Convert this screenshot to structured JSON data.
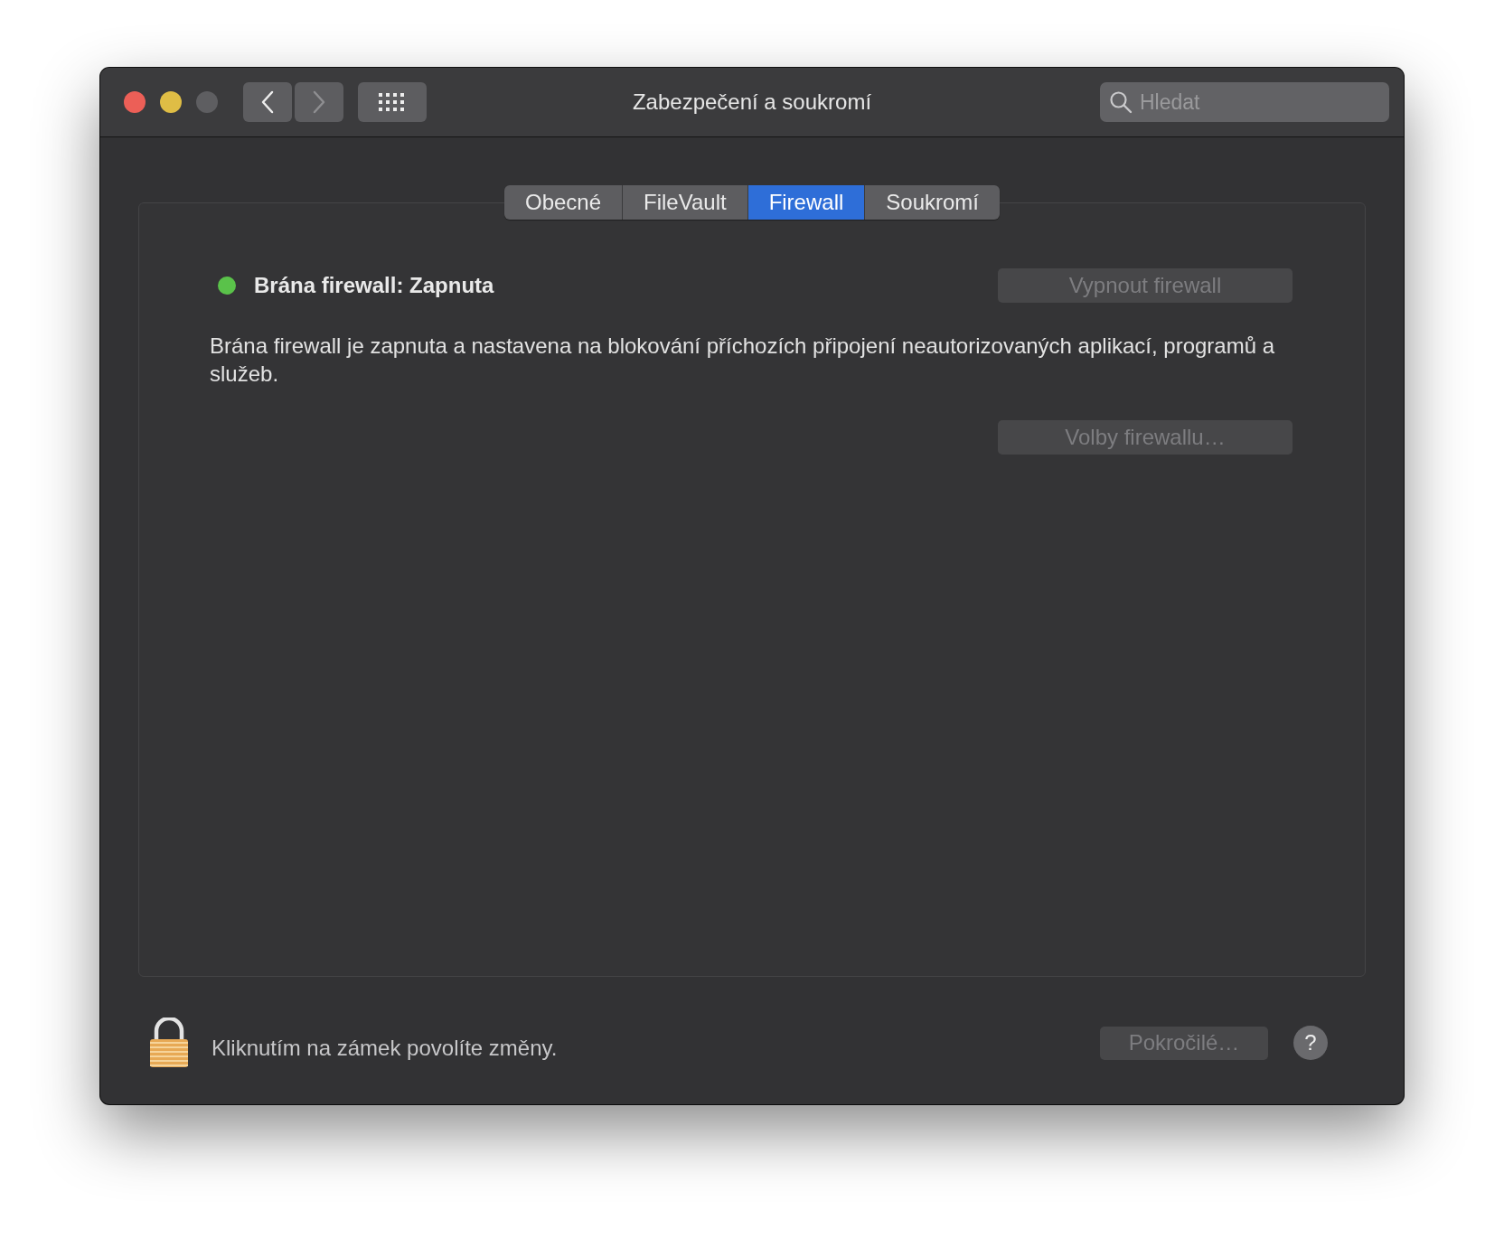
{
  "window": {
    "title": "Zabezpečení a soukromí"
  },
  "window_controls": [
    {
      "kind": "close",
      "disabled": false
    },
    {
      "kind": "minimize",
      "disabled": false
    },
    {
      "kind": "zoom",
      "disabled": true
    }
  ],
  "navigation": [
    {
      "kind": "back",
      "disabled": false
    },
    {
      "kind": "forward",
      "disabled": true
    }
  ],
  "search": {
    "placeholder": "Hledat"
  },
  "tabs": [
    {
      "label": "Obecné",
      "selected": false
    },
    {
      "label": "FileVault",
      "selected": false
    },
    {
      "label": "Firewall",
      "selected": true
    },
    {
      "label": "Soukromí",
      "selected": false
    }
  ],
  "firewall": {
    "status": "Brána firewall: Zapnuta",
    "on": true,
    "toggle_button": {
      "label": "Vypnout firewall",
      "disabled": true
    },
    "description": "Brána firewall je zapnuta a nastavena na blokování příchozích připojení neautorizovaných aplikací, programů a služeb.",
    "options_button": {
      "label": "Volby firewallu…",
      "disabled": true
    }
  },
  "footer": {
    "locked": true,
    "lock_text": "Kliknutím na zámek povolíte změny.",
    "advanced_button": {
      "label": "Pokročilé…",
      "disabled": true
    },
    "help_button": "?"
  }
}
